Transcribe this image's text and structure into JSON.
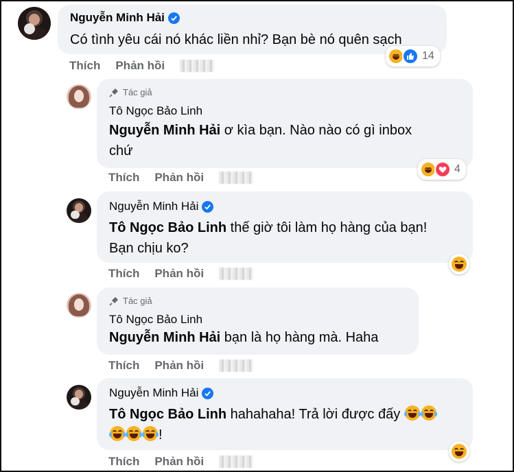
{
  "comments": [
    {
      "author": "Nguyễn Minh Hải",
      "verified": true,
      "text": "Có tình yêu cái nó khác liền nhỉ? Bạn bè nó quên sạch",
      "actions": [
        "Thích",
        "Phản hồi"
      ],
      "reactions": {
        "icons": [
          "haha-icon",
          "like-icon"
        ],
        "count": "14"
      }
    },
    {
      "author_badge": "Tác giả",
      "author": "Tô Ngọc Bảo Linh",
      "mention": "Nguyễn Minh Hải",
      "text_line1": " ơ kìa bạn. Nào nào có gì inbox",
      "text_line2": "chứ",
      "actions": [
        "Thích",
        "Phản hồi"
      ],
      "reactions": {
        "icons": [
          "haha-icon",
          "love-icon"
        ],
        "count": "4"
      }
    },
    {
      "author": "Nguyễn Minh Hải",
      "verified": true,
      "mention": "Tô Ngọc Bảo Linh",
      "text_line1": " thế giờ tôi làm họ hàng của bạn!",
      "text_line2": "Bạn chịu ko?",
      "actions": [
        "Thích",
        "Phản hồi"
      ],
      "reactions": {
        "icons": [
          "haha-icon"
        ]
      }
    },
    {
      "author_badge": "Tác giả",
      "author": "Tô Ngọc Bảo Linh",
      "mention": "Nguyễn Minh Hải",
      "text_line1": " bạn là họ hàng mà. Haha",
      "actions": [
        "Thích",
        "Phản hồi"
      ]
    },
    {
      "author": "Nguyễn Minh Hải",
      "verified": true,
      "mention": "Tô Ngọc Bảo Linh",
      "text_line1": " hahahaha! Trả lời được đấy",
      "text_line2_suffix": "!",
      "actions": [
        "Thích",
        "Phản hồi"
      ],
      "reactions": {
        "icons": [
          "haha-icon"
        ]
      }
    }
  ],
  "colors": {
    "bubble": "#f0f2f5",
    "verified": "#1877f2",
    "meta_text": "#65676b",
    "haha": "#f7b125",
    "love": "#f33e58"
  }
}
